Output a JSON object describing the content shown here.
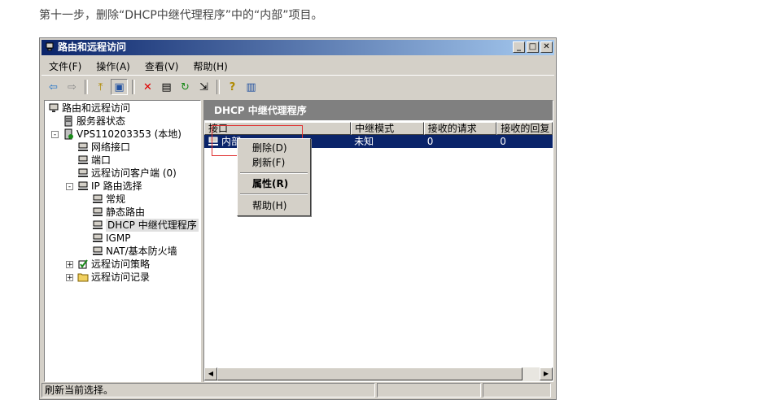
{
  "caption": "第十一步，删除“DHCP中继代理程序”中的“内部”项目。",
  "window": {
    "title": "路由和远程访问",
    "controls": {
      "minimize": "_",
      "maximize": "□",
      "close": "✕"
    }
  },
  "menubar": [
    {
      "label": "文件(F)"
    },
    {
      "label": "操作(A)"
    },
    {
      "label": "查看(V)"
    },
    {
      "label": "帮助(H)"
    }
  ],
  "toolbar": [
    {
      "icon": "back-arrow-icon",
      "glyph": "⇦"
    },
    {
      "icon": "forward-arrow-icon",
      "glyph": "⇨"
    },
    {
      "icon": "up-folder-icon",
      "glyph": "⤒"
    },
    {
      "icon": "show-hide-tree-icon",
      "glyph": "▣"
    },
    {
      "icon": "delete-icon",
      "glyph": "✕"
    },
    {
      "icon": "properties-icon",
      "glyph": "▤"
    },
    {
      "icon": "refresh-icon",
      "glyph": "↻"
    },
    {
      "icon": "export-list-icon",
      "glyph": "⇲"
    },
    {
      "icon": "help-icon",
      "glyph": "?"
    },
    {
      "icon": "action-pane-icon",
      "glyph": "▥"
    }
  ],
  "tree": [
    {
      "label": "路由和远程访问",
      "icon": "computer-icon"
    },
    {
      "label": "服务器状态",
      "icon": "server-status-icon"
    },
    {
      "label": "VPS110203353 (本地)",
      "icon": "server-icon",
      "expander": "-"
    },
    {
      "label": "网络接口",
      "icon": "network-interface-icon"
    },
    {
      "label": "端口",
      "icon": "ports-icon"
    },
    {
      "label": "远程访问客户端 (0)",
      "icon": "remote-clients-icon"
    },
    {
      "label": "IP 路由选择",
      "icon": "ip-routing-icon",
      "expander": "-"
    },
    {
      "label": "常规",
      "icon": "general-icon"
    },
    {
      "label": "静态路由",
      "icon": "static-routes-icon"
    },
    {
      "label": "DHCP 中继代理程序",
      "icon": "dhcp-relay-icon"
    },
    {
      "label": "IGMP",
      "icon": "igmp-icon"
    },
    {
      "label": "NAT/基本防火墙",
      "icon": "nat-firewall-icon"
    },
    {
      "label": "远程访问策略",
      "icon": "policy-icon",
      "expander": "+"
    },
    {
      "label": "远程访问记录",
      "icon": "folder-icon",
      "expander": "+"
    }
  ],
  "pane": {
    "title": "DHCP 中继代理程序",
    "columns": [
      "接口",
      "中继模式",
      "接收的请求",
      "接收的回复"
    ],
    "rows": [
      {
        "cells": [
          "内部",
          "未知",
          "0",
          "0"
        ]
      }
    ]
  },
  "context_menu": {
    "delete": "删除(D)",
    "refresh": "刷新(F)",
    "properties": "属性(R)",
    "help": "帮助(H)"
  },
  "scrollbar": {
    "left_arrow": "◀",
    "right_arrow": "▶"
  },
  "status": {
    "text": "刷新当前选择。"
  },
  "colors": {
    "title_start": "#0a246a",
    "title_end": "#a6caf0",
    "selection": "#0a246a",
    "highlight_box": "#e03030"
  }
}
